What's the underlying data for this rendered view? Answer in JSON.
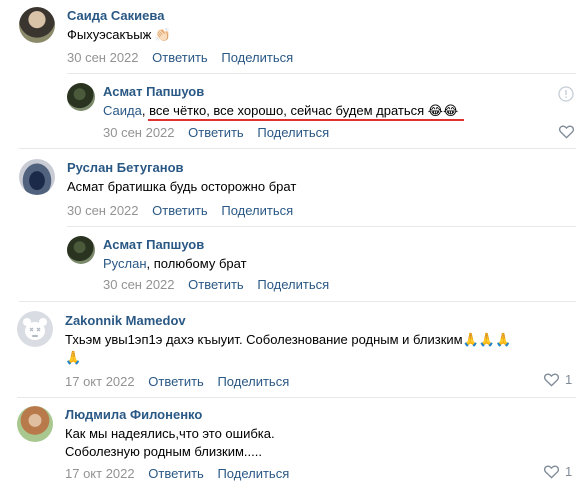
{
  "actions": {
    "reply": "Ответить",
    "share": "Поделиться"
  },
  "comments": [
    {
      "author": "Саида Сакиева",
      "text": "Фыхуэсакъыж",
      "emoji": "👏🏻",
      "date": "30 сен 2022"
    },
    {
      "author": "Асмат Папшуов",
      "reply_to": "Саида",
      "text": ", все чётко, все хорошо, сейчас будем драться ",
      "emoji": "😂😂",
      "date": "30 сен 2022"
    },
    {
      "author": "Руслан Бетуганов",
      "text": "Асмат братишка будь осторожно брат",
      "date": "30 сен 2022"
    },
    {
      "author": "Асмат Папшуов",
      "reply_to": "Руслан",
      "text": ", полюбому брат",
      "date": "30 сен 2022"
    },
    {
      "author": "Zakonnik Mamedov",
      "text_line1": "Тхьэм увы1эп1э дахэ къыуит. Соболезнование родным и близким",
      "emoji_line1": "🙏🙏🙏",
      "emoji_line2": "🙏",
      "date": "17 окт 2022",
      "likes": "1"
    },
    {
      "author": "Людмила Филоненко",
      "text_line1": "Как мы надеялись,что это ошибка.",
      "text_line2": "Соболезную родным близким.....",
      "date": "17 окт 2022",
      "likes": "1"
    }
  ],
  "colors": {
    "link": "#2a5885",
    "meta": "#939393",
    "underline": "#e03030"
  }
}
